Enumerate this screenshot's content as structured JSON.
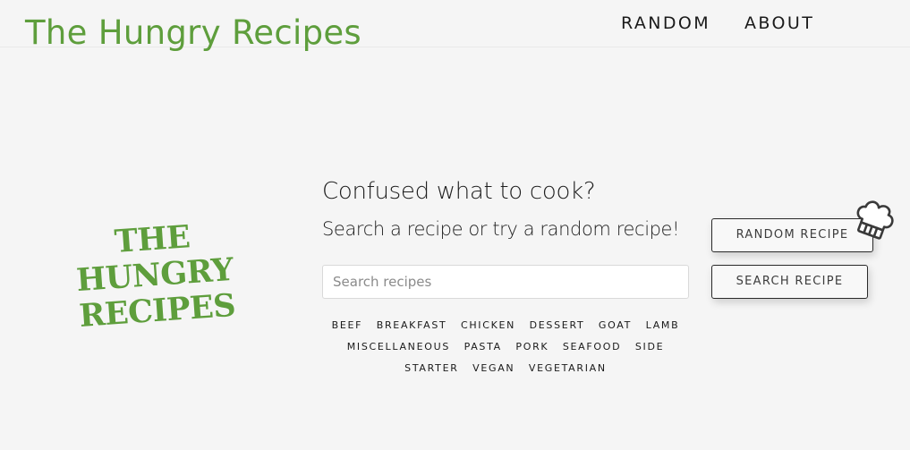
{
  "header": {
    "brand": "The Hungry Recipes",
    "nav": {
      "random": "RANDOM",
      "about": "ABOUT"
    }
  },
  "logo": {
    "line1": "THE HUNGRY",
    "line2": "RECIPES"
  },
  "hero": {
    "title": "Confused what to cook?",
    "subtitle": "Search a recipe or try a random recipe!"
  },
  "search": {
    "placeholder": "Search recipes",
    "value": ""
  },
  "buttons": {
    "random_recipe": "RANDOM RECIPE",
    "search_recipe": "SEARCH RECIPE"
  },
  "categories": [
    "BEEF",
    "BREAKFAST",
    "CHICKEN",
    "DESSERT",
    "GOAT",
    "LAMB",
    "MISCELLANEOUS",
    "PASTA",
    "PORK",
    "SEAFOOD",
    "SIDE",
    "STARTER",
    "VEGAN",
    "VEGETARIAN"
  ],
  "colors": {
    "brand_green": "#5e9e3c",
    "background": "#f5f5f5",
    "text": "#1e1e1e"
  },
  "icons": {
    "chef_hat": "chef-hat-icon"
  }
}
